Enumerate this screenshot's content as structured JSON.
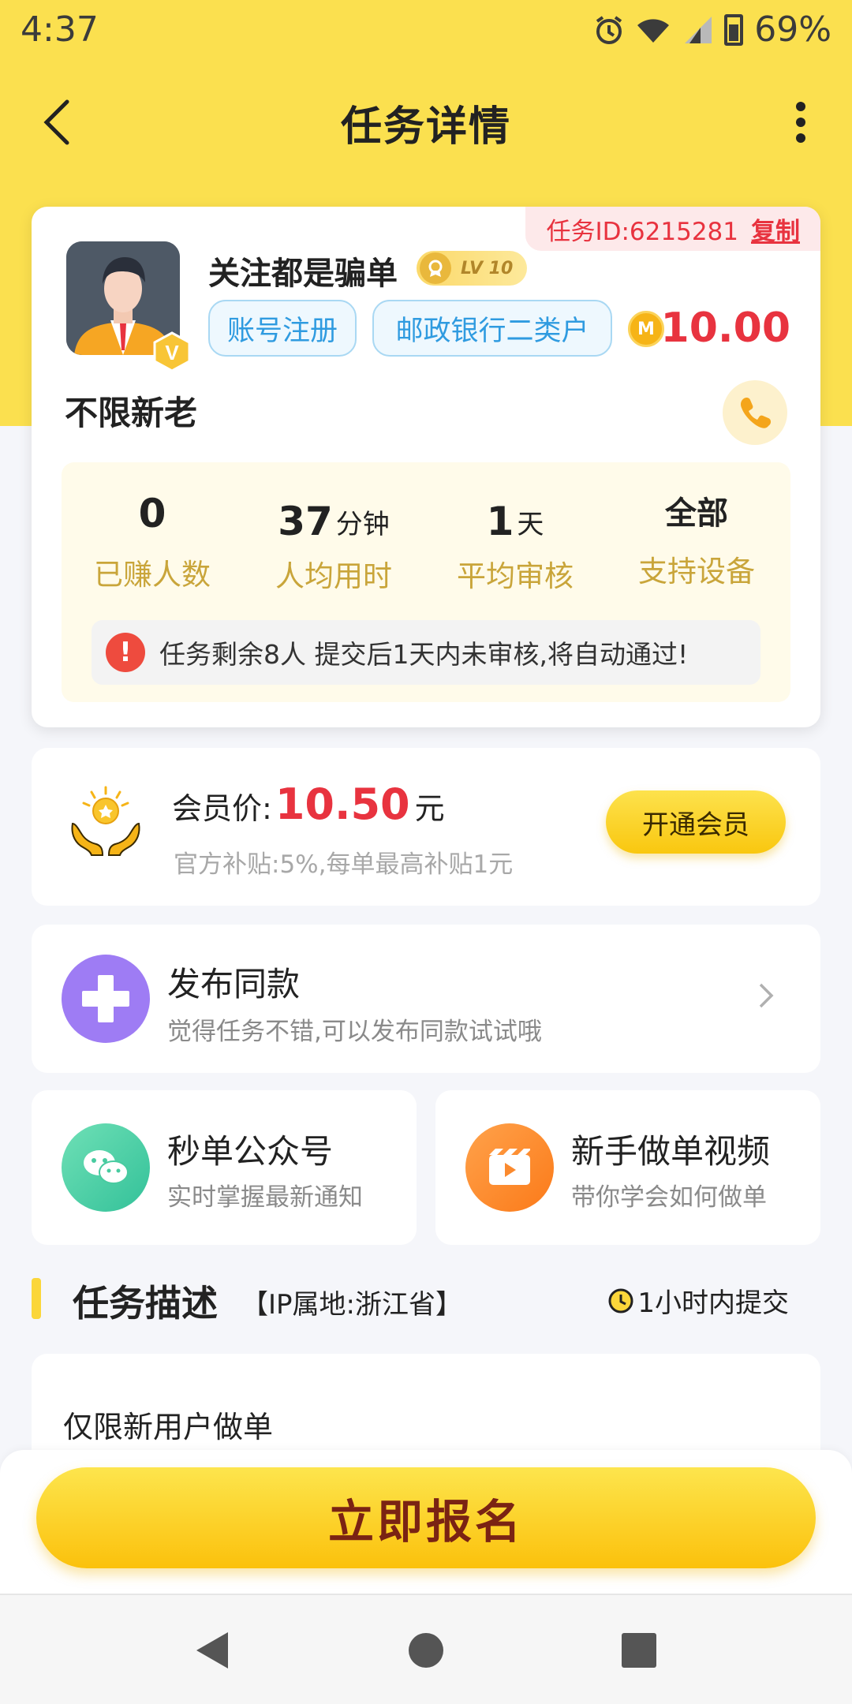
{
  "status_bar": {
    "time": "4:37",
    "battery": "69%"
  },
  "app_bar": {
    "title": "任务详情"
  },
  "task": {
    "id_label": "任务ID:6215281",
    "copy_label": "复制",
    "publisher_name": "关注都是骗单",
    "level": "LV 10",
    "tags": [
      "账号注册",
      "邮政银行二类户"
    ],
    "coin_symbol": "M",
    "reward": "10.00",
    "audience": "不限新老",
    "stats": [
      {
        "value": "0",
        "unit": "",
        "label": "已赚人数"
      },
      {
        "value": "37",
        "unit": "分钟",
        "label": "人均用时"
      },
      {
        "value": "1",
        "unit": "天",
        "label": "平均审核"
      },
      {
        "value": "全部",
        "unit": "",
        "label": "支持设备"
      }
    ],
    "notice_icon": "!",
    "notice": "任务剩余8人  提交后1天内未审核,将自动通过!"
  },
  "member": {
    "label": "会员价:",
    "price": "10.50",
    "unit": "元",
    "subsidy": "官方补贴:5%,每单最高补贴1元",
    "button": "开通会员"
  },
  "publish_same": {
    "title": "发布同款",
    "subtitle": "觉得任务不错,可以发布同款试试哦"
  },
  "mini_cards": [
    {
      "title": "秒单公众号",
      "subtitle": "实时掌握最新通知",
      "color": "#4fd1a6"
    },
    {
      "title": "新手做单视频",
      "subtitle": "带你学会如何做单",
      "color": "#fc8a2e"
    }
  ],
  "description": {
    "section_title": "任务描述",
    "ip_location": "【IP属地:浙江省】",
    "deadline": "1小时内提交",
    "text": "仅限新用户做单"
  },
  "cta": {
    "label": "立即报名"
  },
  "colors": {
    "brand_yellow": "#fbe04f",
    "price_red": "#e8333f",
    "tag_blue": "#2f9be0",
    "stat_gold": "#c9a53a"
  }
}
